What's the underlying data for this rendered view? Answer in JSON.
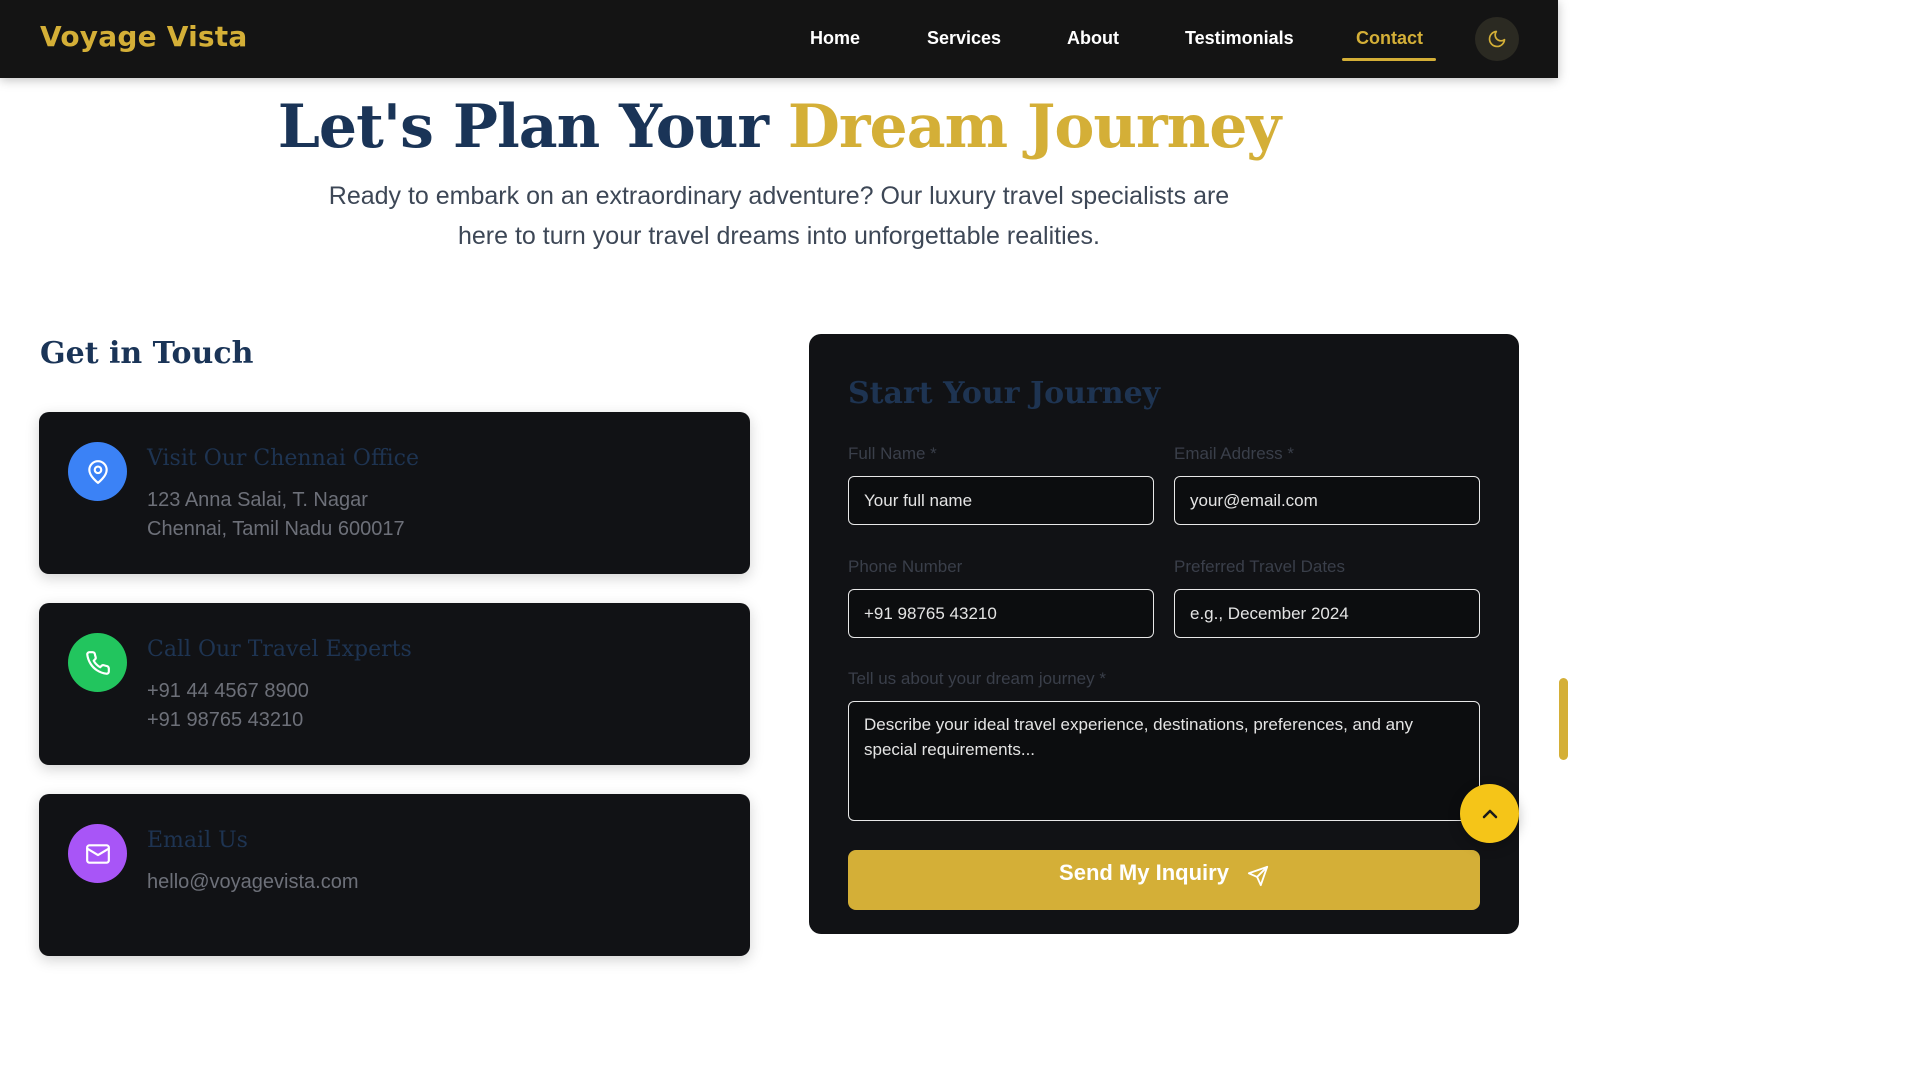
{
  "brand": "Voyage Vista",
  "nav": {
    "items": [
      {
        "label": "Home"
      },
      {
        "label": "Services"
      },
      {
        "label": "About"
      },
      {
        "label": "Testimonials"
      },
      {
        "label": "Contact"
      }
    ],
    "active": "Contact",
    "theme_toggle_icon": "moon-icon"
  },
  "hero": {
    "title_main": "Let's Plan Your ",
    "title_accent": "Dream Journey",
    "subtitle_line1": "Ready to embark on an extraordinary adventure? Our luxury travel specialists are",
    "subtitle_line2": "here to turn your travel dreams into unforgettable realities."
  },
  "contact": {
    "heading": "Get in Touch",
    "cards": [
      {
        "icon": "map-pin-icon",
        "color": "#3b82f6",
        "title": "Visit Our Chennai Office",
        "lines": [
          "123 Anna Salai, T. Nagar",
          "Chennai, Tamil Nadu 600017"
        ]
      },
      {
        "icon": "phone-icon",
        "color": "#22c55e",
        "title": "Call Our Travel Experts",
        "lines": [
          "+91 44 4567 8900",
          "+91 98765 43210"
        ]
      },
      {
        "icon": "mail-icon",
        "color": "#a855f7",
        "title": "Email Us",
        "lines": [
          "hello@voyagevista.com"
        ]
      }
    ]
  },
  "form": {
    "title": "Start Your Journey",
    "full_name": {
      "label": "Full Name *",
      "placeholder": "Your full name"
    },
    "email": {
      "label": "Email Address *",
      "placeholder": "your@email.com"
    },
    "phone": {
      "label": "Phone Number",
      "placeholder": "+91 98765 43210"
    },
    "dates": {
      "label": "Preferred Travel Dates",
      "placeholder": "e.g., December 2024"
    },
    "message": {
      "label": "Tell us about your dream journey *",
      "placeholder": "Describe your ideal travel experience, destinations, preferences, and any special requirements..."
    },
    "submit_label": "Send My Inquiry",
    "submit_icon": "send-icon"
  },
  "colors": {
    "gold": "#d4af37",
    "navy": "#1a3457",
    "dark_card": "#111215",
    "back_to_top": "#f5c518"
  },
  "back_to_top_icon": "chevron-up-icon"
}
